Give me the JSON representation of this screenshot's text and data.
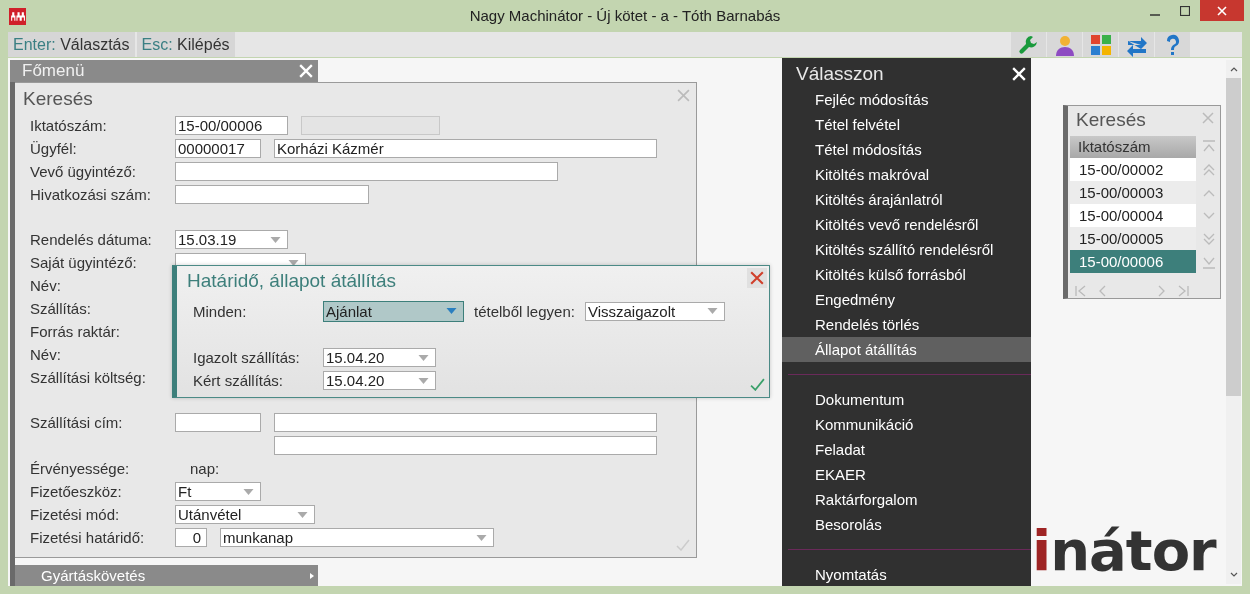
{
  "window": {
    "title": "Nagy Machinátor - Új kötet - a - Tóth Barnabás"
  },
  "hints": [
    {
      "key": "Enter:",
      "label": "Választás"
    },
    {
      "key": "Esc:",
      "label": "Kilépés"
    }
  ],
  "main_menu": {
    "title": "Főmenü",
    "items": [
      {
        "label": "Gyártáskövetés"
      }
    ]
  },
  "search_form": {
    "title": "Keresés",
    "groups": [
      [
        {
          "label": "Iktatószám:",
          "inputs": [
            {
              "kind": "text",
              "value": "15-00/00006",
              "disabled": false
            },
            {
              "kind": "text",
              "disabled": true
            }
          ]
        },
        {
          "label": "Ügyfél:",
          "inputs": [
            {
              "kind": "text",
              "value": "00000017",
              "disabled": false
            },
            {
              "kind": "text",
              "value": "Korházi Kázmér",
              "disabled": false
            }
          ]
        },
        {
          "label": "Vevő ügyintéző:",
          "inputs": [
            {
              "kind": "text",
              "disabled": false
            }
          ]
        },
        {
          "label": "Hivatkozási szám:",
          "inputs": [
            {
              "kind": "text",
              "disabled": false
            }
          ]
        }
      ],
      [
        {
          "label": "Rendelés dátuma:",
          "inputs": [
            {
              "kind": "select",
              "value": "15.03.19"
            }
          ]
        },
        {
          "label": "Saját ügyintéző:",
          "inputs": [
            {
              "kind": "select"
            }
          ]
        },
        {
          "label": "Név:"
        },
        {
          "label": "Szállítás:"
        },
        {
          "label": "Forrás raktár:"
        },
        {
          "label": "Név:"
        },
        {
          "label": "Szállítási költség:"
        }
      ],
      [
        {
          "label": "Szállítási cím:",
          "inputs": [
            {
              "kind": "text",
              "disabled": false
            },
            {
              "kind": "text",
              "disabled": false
            }
          ]
        },
        {
          "inputs": [
            {
              "kind": "text",
              "disabled": false
            }
          ]
        },
        {
          "label": "Érvényessége:",
          "inputs": [
            {
              "kind": "static",
              "value": "nap:"
            }
          ]
        },
        {
          "label": "Fizetőeszköz:",
          "inputs": [
            {
              "kind": "select",
              "value": "Ft"
            }
          ]
        },
        {
          "label": "Fizetési mód:",
          "inputs": [
            {
              "kind": "select",
              "value": "Utánvétel"
            }
          ]
        },
        {
          "label": "Fizetési határidő:",
          "inputs": [
            {
              "kind": "number",
              "value": "0",
              "disabled": false
            },
            {
              "kind": "select",
              "value": "munkanap"
            }
          ]
        }
      ]
    ]
  },
  "dialog": {
    "title": "Határidő, állapot átállítás",
    "label_1": "Minden:",
    "from_select": {
      "value": "Ajánlat",
      "focused": true
    },
    "label_2": "tételből legyen:",
    "to_select": {
      "value": "Visszaigazolt",
      "focused": false
    },
    "dates": [
      {
        "label": "Igazolt szállítás:",
        "value": "15.04.20"
      },
      {
        "label": "Kért szállítás:",
        "value": "15.04.20"
      }
    ]
  },
  "action_menu": {
    "title": "Válasszon",
    "sections": [
      [
        {
          "label": "Fejléc módosítás",
          "selected": false
        },
        {
          "label": "Tétel felvétel",
          "selected": false
        },
        {
          "label": "Tétel módosítás",
          "selected": false
        },
        {
          "label": "Kitöltés makróval",
          "selected": false
        },
        {
          "label": "Kitöltés árajánlatról",
          "selected": false
        },
        {
          "label": "Kitöltés vevő rendelésről",
          "selected": false
        },
        {
          "label": "Kitöltés szállító rendelésről",
          "selected": false
        },
        {
          "label": "Kitöltés külső forrásból",
          "selected": false
        },
        {
          "label": "Engedmény",
          "selected": false
        },
        {
          "label": "Rendelés törlés",
          "selected": false
        },
        {
          "label": "Állapot átállítás",
          "selected": true
        }
      ],
      [
        {
          "label": "Dokumentum",
          "selected": false
        },
        {
          "label": "Kommunikáció",
          "selected": false
        },
        {
          "label": "Feladat",
          "selected": false
        },
        {
          "label": "EKAER",
          "selected": false
        },
        {
          "label": "Raktárforgalom",
          "selected": false
        },
        {
          "label": "Besorolás",
          "selected": false
        }
      ],
      [
        {
          "label": "Nyomtatás",
          "selected": false
        }
      ]
    ]
  },
  "logo": {
    "accent": "i",
    "rest": "nátor"
  },
  "search_list": {
    "title": "Keresés",
    "column": "Iktatószám",
    "rows": [
      {
        "value": "15-00/00002",
        "selected": false
      },
      {
        "value": "15-00/00003",
        "selected": false
      },
      {
        "value": "15-00/00004",
        "selected": false
      },
      {
        "value": "15-00/00005",
        "selected": false
      },
      {
        "value": "15-00/00006",
        "selected": true
      }
    ]
  }
}
